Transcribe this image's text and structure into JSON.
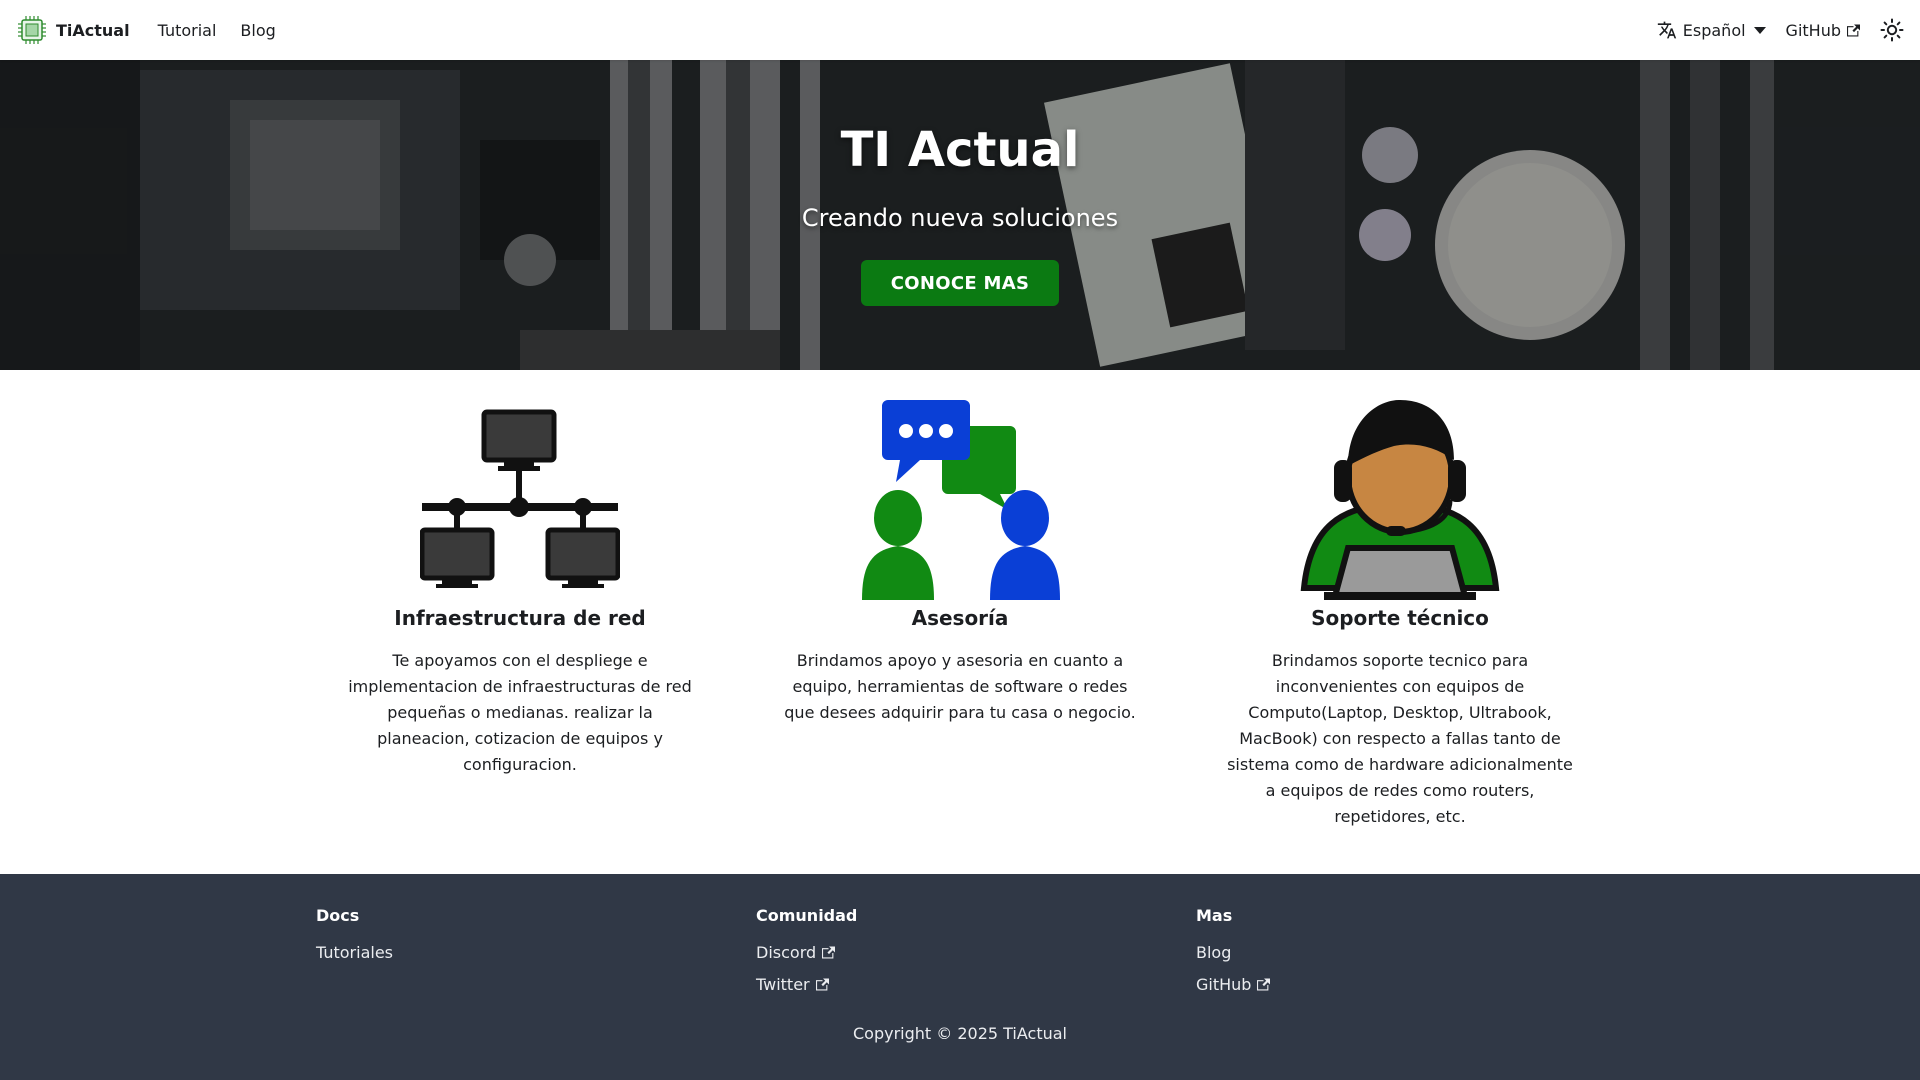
{
  "navbar": {
    "brand": "TiActual",
    "links": [
      "Tutorial",
      "Blog"
    ],
    "language": "Español",
    "github": "GitHub",
    "theme_icon": "sun-icon"
  },
  "hero": {
    "title": "TI Actual",
    "subtitle": "Creando nueva soluciones",
    "cta": "CONOCE MAS"
  },
  "features": [
    {
      "icon": "network-infrastructure-icon",
      "title": "Infraestructura de red",
      "text": "Te apoyamos con el despliege e implementacion de infraestructuras de red pequeñas o medianas. realizar la planeacion, cotizacion de equipos y configuracion."
    },
    {
      "icon": "consulting-chat-icon",
      "title": "Asesoría",
      "text": "Brindamos apoyo y asesoria en cuanto a equipo, herramientas de software o redes que desees adquirir para tu casa o negocio."
    },
    {
      "icon": "support-agent-icon",
      "title": "Soporte técnico",
      "text": "Brindamos soporte tecnico para inconvenientes con equipos de Computo(Laptop, Desktop, Ultrabook, MacBook) con respecto a fallas tanto de sistema como de hardware adicionalmente a equipos de redes como routers, repetidores, etc."
    }
  ],
  "footer": {
    "columns": [
      {
        "title": "Docs",
        "links": [
          "Tutoriales"
        ]
      },
      {
        "title": "Comunidad",
        "links": [
          "Discord",
          "Twitter"
        ]
      },
      {
        "title": "Mas",
        "links": [
          "Blog",
          "GitHub"
        ]
      }
    ],
    "copyright": "Copyright © 2025 TiActual"
  },
  "colors": {
    "accent": "#0b7a12",
    "footer_bg": "#303846",
    "icon_blue": "#0a3fd6",
    "icon_green": "#118a13"
  }
}
